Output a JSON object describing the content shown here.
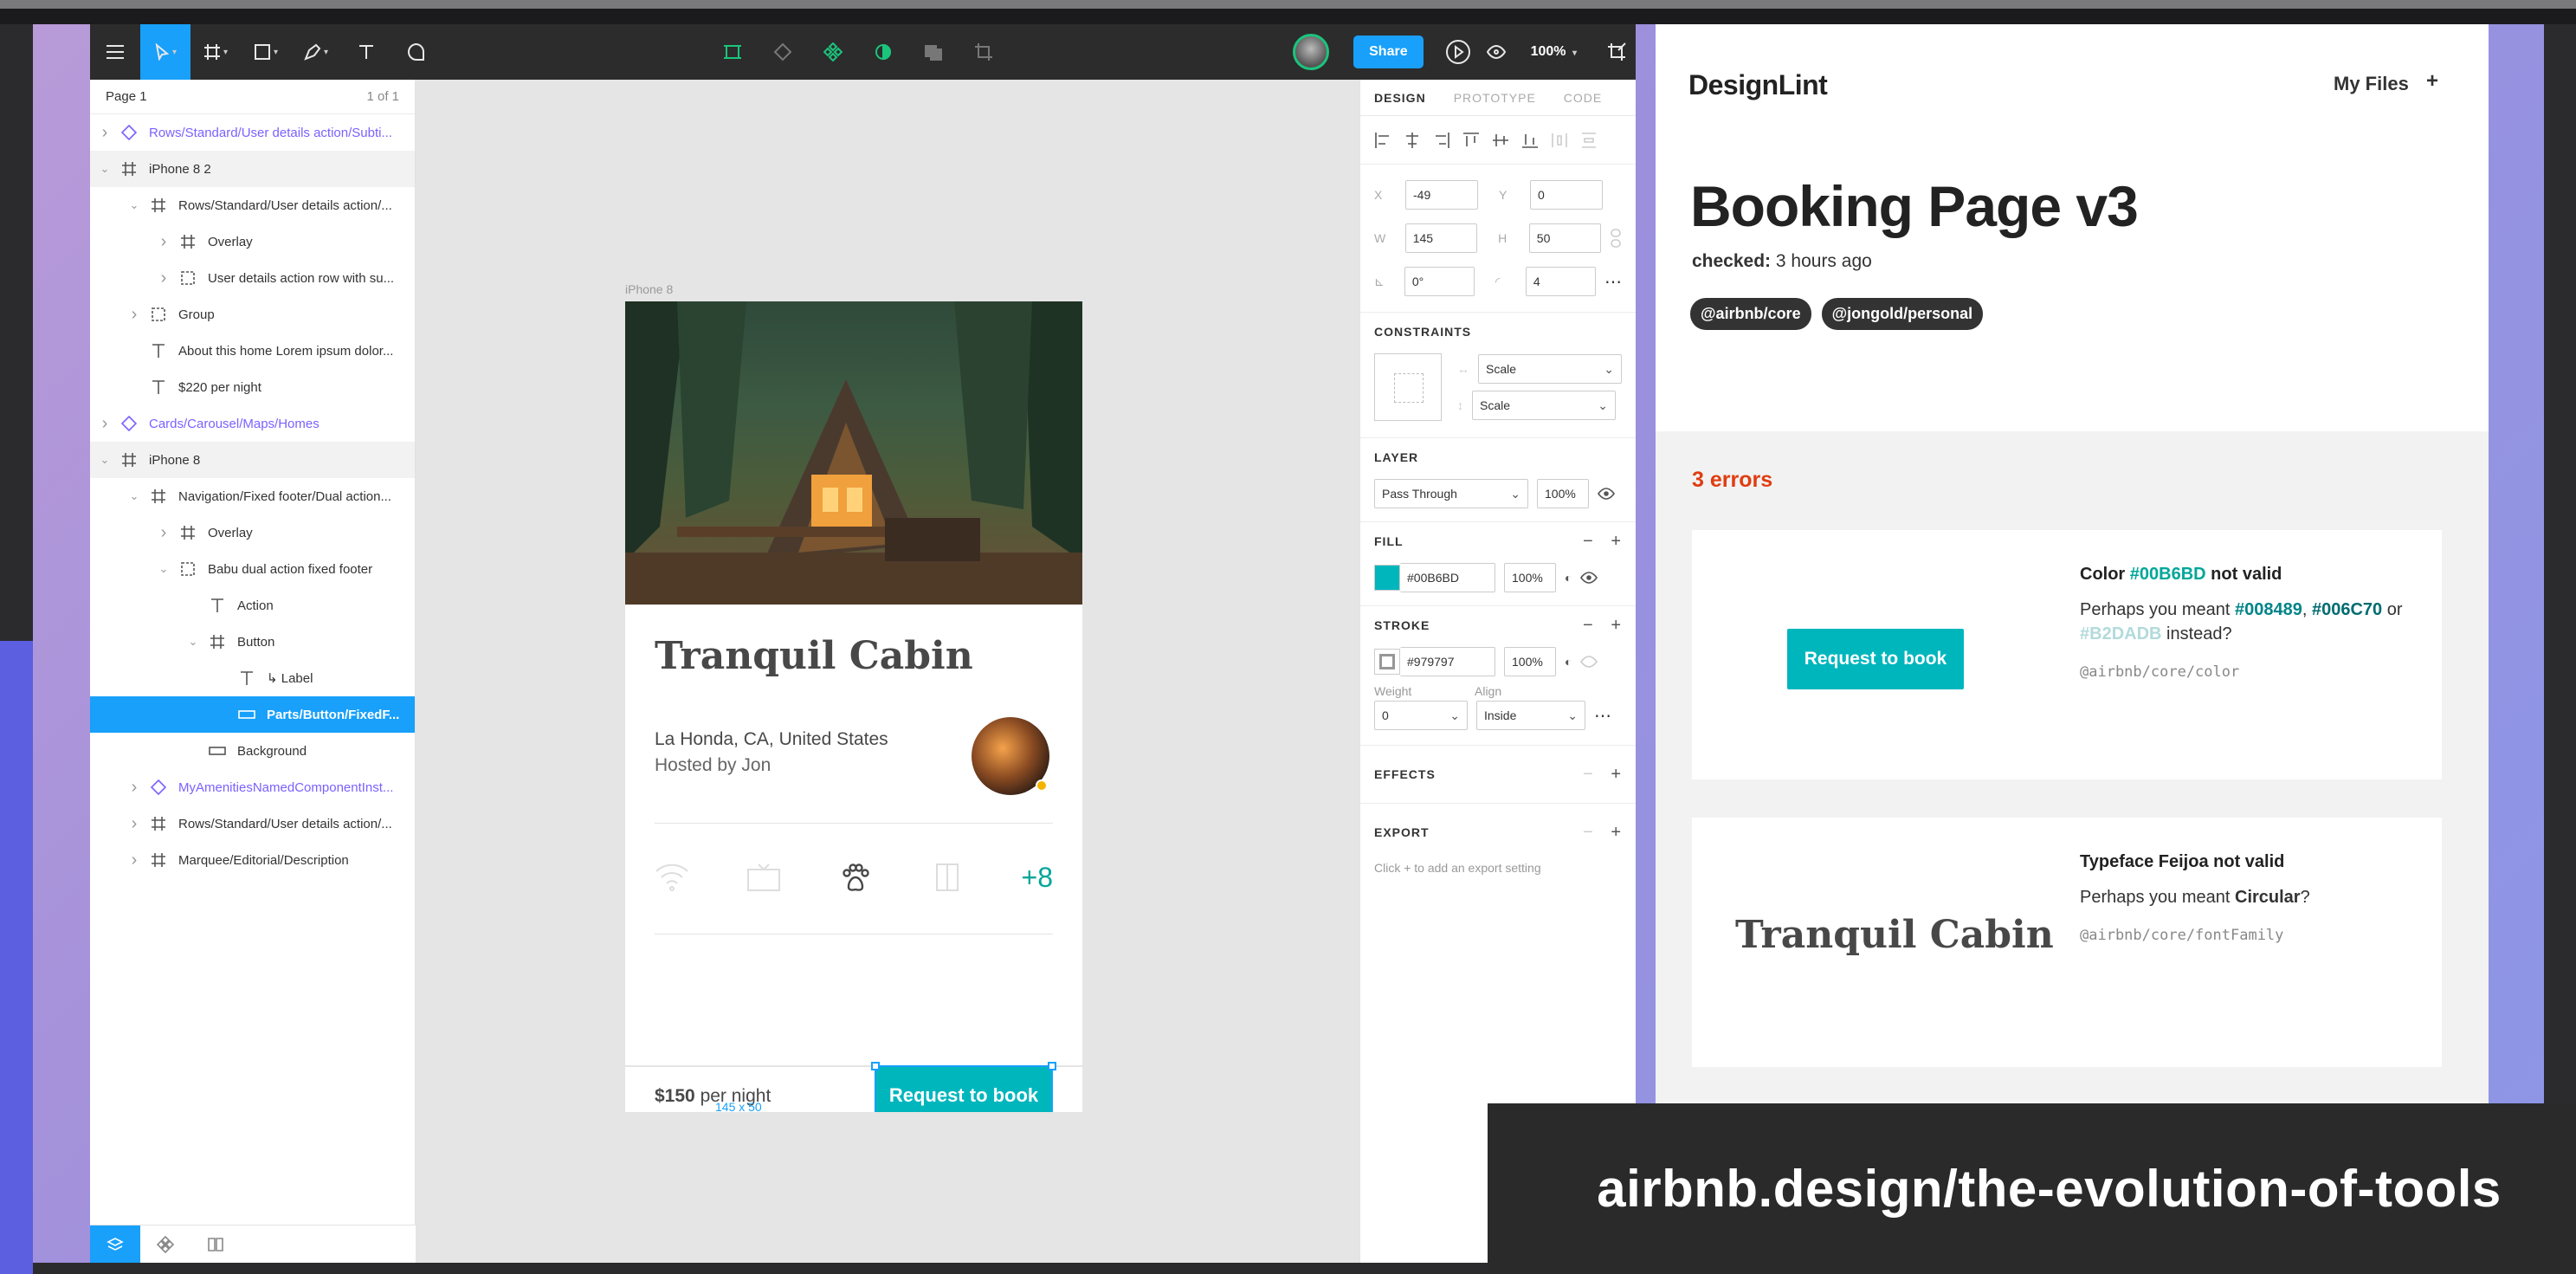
{
  "figma": {
    "share_label": "Share",
    "zoom": "100%",
    "page": {
      "name": "Page 1",
      "count": "1 of 1"
    },
    "layers": [
      {
        "label": "Rows/Standard/User details action/Subti...",
        "kind": "component",
        "indent": 0,
        "chev": "right",
        "icon": "component"
      },
      {
        "label": "iPhone 8 2",
        "kind": "frame",
        "indent": 0,
        "chev": "down",
        "icon": "frame"
      },
      {
        "label": "Rows/Standard/User details action/...",
        "kind": "normal",
        "indent": 1,
        "chev": "down",
        "icon": "frame"
      },
      {
        "label": "Overlay",
        "kind": "normal",
        "indent": 2,
        "chev": "right",
        "icon": "frame"
      },
      {
        "label": "User details action row with su...",
        "kind": "normal",
        "indent": 2,
        "chev": "right",
        "icon": "group"
      },
      {
        "label": "Group",
        "kind": "normal",
        "indent": 1,
        "chev": "right",
        "icon": "group"
      },
      {
        "label": "About this home Lorem ipsum dolor...",
        "kind": "normal",
        "indent": 1,
        "chev": "",
        "icon": "text"
      },
      {
        "label": "$220 per night",
        "kind": "normal",
        "indent": 1,
        "chev": "",
        "icon": "text"
      },
      {
        "label": "Cards/Carousel/Maps/Homes",
        "kind": "component",
        "indent": 0,
        "chev": "right",
        "icon": "component"
      },
      {
        "label": "iPhone 8",
        "kind": "frame",
        "indent": 0,
        "chev": "down",
        "icon": "frame"
      },
      {
        "label": "Navigation/Fixed footer/Dual action...",
        "kind": "normal",
        "indent": 1,
        "chev": "down",
        "icon": "frame"
      },
      {
        "label": "Overlay",
        "kind": "normal",
        "indent": 2,
        "chev": "right",
        "icon": "frame"
      },
      {
        "label": "Babu dual action fixed footer",
        "kind": "normal",
        "indent": 2,
        "chev": "down",
        "icon": "group"
      },
      {
        "label": "Action",
        "kind": "normal",
        "indent": 3,
        "chev": "",
        "icon": "text"
      },
      {
        "label": "Button",
        "kind": "normal",
        "indent": 3,
        "chev": "down",
        "icon": "frame"
      },
      {
        "label": "↳ Label",
        "kind": "normal",
        "indent": 4,
        "chev": "",
        "icon": "text"
      },
      {
        "label": "Parts/Button/FixedF...",
        "kind": "sel",
        "indent": 4,
        "chev": "",
        "icon": "rect"
      },
      {
        "label": "Background",
        "kind": "normal",
        "indent": 3,
        "chev": "",
        "icon": "rect"
      },
      {
        "label": "MyAmenitiesNamedComponentInst...",
        "kind": "component",
        "indent": 1,
        "chev": "right",
        "icon": "component"
      },
      {
        "label": "Rows/Standard/User details action/...",
        "kind": "normal",
        "indent": 1,
        "chev": "right",
        "icon": "frame"
      },
      {
        "label": "Marquee/Editorial/Description",
        "kind": "normal",
        "indent": 1,
        "chev": "right",
        "icon": "frame"
      }
    ],
    "canvas": {
      "frame_label": "iPhone 8",
      "title": "Tranquil Cabin",
      "location": "La Honda, CA, United States",
      "host": "Hosted by Jon",
      "amenities_more": "+8",
      "price": "$150",
      "price_unit": "per night",
      "book_label": "Request to book",
      "size_label": "145 x 50"
    },
    "props": {
      "tabs": [
        "DESIGN",
        "PROTOTYPE",
        "CODE"
      ],
      "x": "-49",
      "y": "0",
      "w": "145",
      "h": "50",
      "rotation": "0°",
      "radius": "4",
      "labels": {
        "x": "X",
        "y": "Y",
        "w": "W",
        "h": "H"
      },
      "constraints_title": "CONSTRAINTS",
      "constraint_h": "Scale",
      "constraint_v": "Scale",
      "layer_title": "LAYER",
      "blend": "Pass Through",
      "layer_opacity": "100%",
      "fill_title": "FILL",
      "fill_hex": "#00B6BD",
      "fill_opacity": "100%",
      "fill_color": "#00B6BD",
      "stroke_title": "STROKE",
      "stroke_hex": "#979797",
      "stroke_opacity": "100%",
      "stroke_color": "#979797",
      "weight_label": "Weight",
      "align_label": "Align",
      "weight": "0",
      "align": "Inside",
      "effects_title": "EFFECTS",
      "export_title": "EXPORT",
      "export_hint": "Click + to add an export setting"
    }
  },
  "designlint": {
    "logo": "DesignLint",
    "my_files": "My Files",
    "plus": "+",
    "title": "Booking Page v3",
    "checked_label": "checked:",
    "checked_value": "3 hours ago",
    "tags": [
      "@airbnb/core",
      "@jongold/personal"
    ],
    "errors_count": "3 errors",
    "card1": {
      "button_label": "Request to book",
      "head_prefix": "Color ",
      "head_value": "#00B6BD",
      "head_suffix": " not valid",
      "body_prefix": "Perhaps you meant ",
      "opt1": "#008489",
      "sep1": ",",
      "opt2": "#006C70",
      "sep2": " or ",
      "opt3": "#B2DADB",
      "body_suffix": " instead?",
      "rule": "@airbnb/core/color"
    },
    "card2": {
      "sample": "Tranquil Cabin",
      "head": "Typeface Feijoa not valid",
      "body_prefix": "Perhaps you meant ",
      "body_value": "Circular",
      "body_suffix": "?",
      "rule": "@airbnb/core/fontFamily"
    }
  },
  "overlay_text": "airbnb.design/the-evolution-of-tools",
  "colors": {
    "accent": "#18A0FB",
    "teal": "#00B6BD",
    "error": "#E03D10",
    "component": "#7B61FF"
  }
}
